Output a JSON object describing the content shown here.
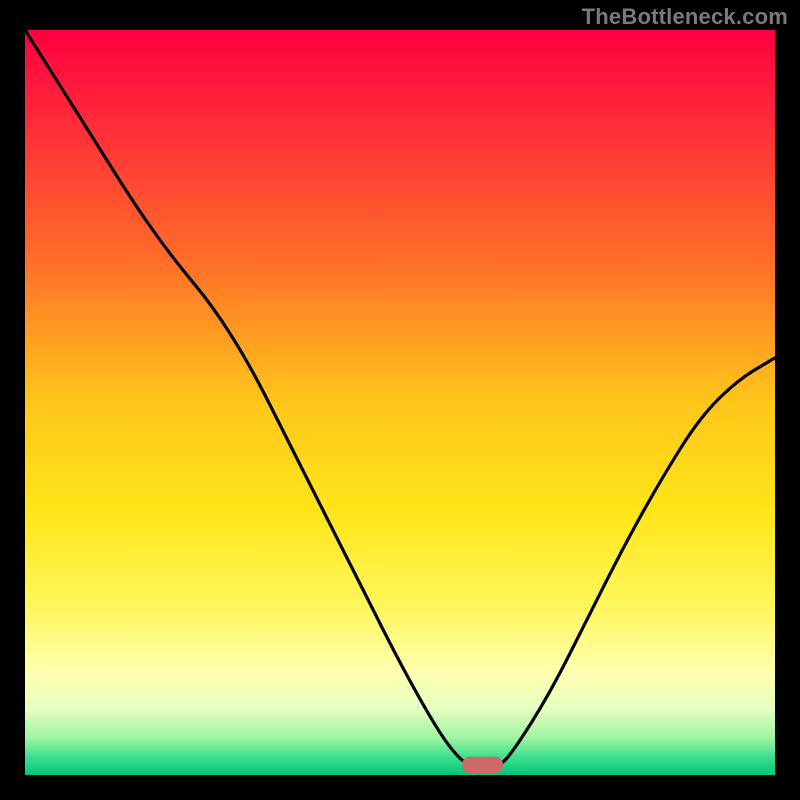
{
  "watermark": "TheBottleneck.com",
  "chart_data": {
    "type": "line",
    "title": "",
    "xlabel": "",
    "ylabel": "",
    "x_range": [
      0,
      100
    ],
    "y_range": [
      0,
      100
    ],
    "series": [
      {
        "name": "bottleneck-curve",
        "x": [
          0,
          5,
          10,
          15,
          20,
          25,
          30,
          35,
          40,
          45,
          50,
          55,
          58,
          60,
          63,
          65,
          70,
          75,
          80,
          85,
          90,
          95,
          100
        ],
        "y": [
          100,
          92,
          84,
          76,
          69,
          63,
          55,
          45,
          35,
          25,
          15,
          6,
          2,
          1,
          1,
          3,
          11,
          21,
          31,
          40,
          48,
          53,
          56
        ]
      }
    ],
    "gradient_stops": [
      {
        "offset": 0.0,
        "color": "#ff0040"
      },
      {
        "offset": 0.12,
        "color": "#ff2a3a"
      },
      {
        "offset": 0.3,
        "color": "#ff6a2a"
      },
      {
        "offset": 0.5,
        "color": "#ffc61a"
      },
      {
        "offset": 0.65,
        "color": "#ffe61a"
      },
      {
        "offset": 0.78,
        "color": "#fff760"
      },
      {
        "offset": 0.86,
        "color": "#ffffb0"
      },
      {
        "offset": 0.91,
        "color": "#e6ffc0"
      },
      {
        "offset": 0.95,
        "color": "#a0f5a0"
      },
      {
        "offset": 0.975,
        "color": "#40e090"
      },
      {
        "offset": 1.0,
        "color": "#00c878"
      }
    ],
    "marker": {
      "x": 61,
      "width": 5.5,
      "height": 2.2,
      "rx": 1.1,
      "color": "#cb6a66",
      "name": "bottleneck-marker"
    }
  }
}
